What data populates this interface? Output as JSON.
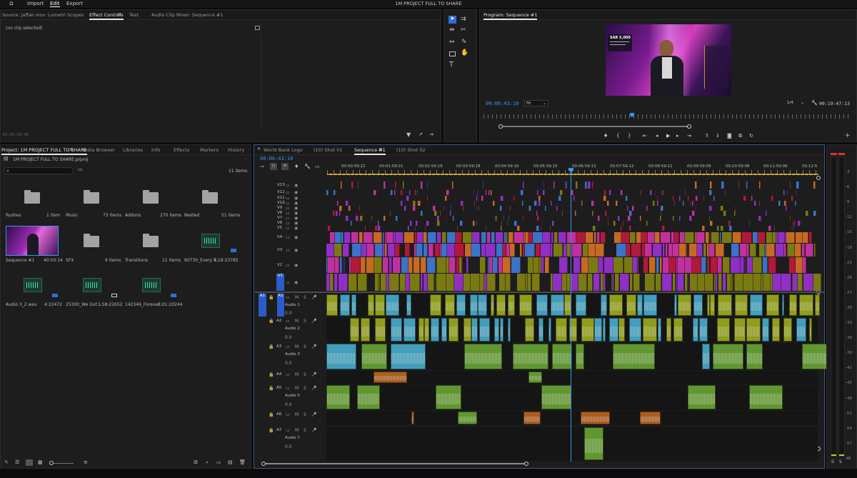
{
  "menu": {
    "home_icon": "home-icon",
    "items": [
      "Import",
      "Edit",
      "Export"
    ],
    "active": "Edit",
    "title": "1M PROJECT FULL  TO SHARE"
  },
  "source_panel": {
    "tabs": [
      "Source: jaffali.mov",
      "Lumetri Scopes",
      "Effect Controls",
      "Text",
      "Audio Clip Mixer: Sequence #1"
    ],
    "active_tab": "Effect Controls",
    "no_clip": "(no clip selected)",
    "timecode": "00:00:00:00"
  },
  "tools": [
    "selection-tool",
    "track-select-tool",
    "ripple-edit-tool",
    "razor-tool",
    "slip-tool",
    "pen-tool",
    "rectangle-tool",
    "hand-tool",
    "type-tool"
  ],
  "program_monitor": {
    "title": "Program: Sequence #1",
    "timecode": "00:06:43:10",
    "fit": "Fit",
    "resolution": "1/4",
    "duration": "00:19:47:13",
    "overlay_price": "SAR 5,000",
    "playhead_fraction": 0.325
  },
  "project_panel": {
    "tabs": [
      "Project: 1M PROJECT FULL  TO SHARE",
      "Media Browser",
      "Libraries",
      "Info",
      "Effects",
      "Markers",
      "History"
    ],
    "file": "1M PROJECT FULL  TO SHARE.prproj",
    "search_placeholder": "",
    "count": "11 items",
    "items": [
      {
        "name": "Rushes",
        "meta": "1 item",
        "kind": "folder"
      },
      {
        "name": "Music",
        "meta": "73 items",
        "kind": "folder"
      },
      {
        "name": "Addons",
        "meta": "270 items",
        "kind": "folder"
      },
      {
        "name": "Nested",
        "meta": "51 items",
        "kind": "folder"
      },
      {
        "name": "Sequence #1",
        "meta": "40:50:14",
        "kind": "sequence"
      },
      {
        "name": "SFX",
        "meta": "9 items",
        "kind": "folder"
      },
      {
        "name": "Transitions",
        "meta": "11 items",
        "kind": "folder"
      },
      {
        "name": "60730_Every T...",
        "meta": "4:18:23785",
        "kind": "audio"
      },
      {
        "name": "Audio 3_2.wav",
        "meta": "4:22472",
        "kind": "audio"
      },
      {
        "name": "25300_We Got ...",
        "meta": "1:58:22652",
        "kind": "audio"
      },
      {
        "name": "142346_Forever...",
        "meta": "2:01:20244",
        "kind": "audio"
      }
    ]
  },
  "timeline": {
    "tabs": [
      "World Bank Logo",
      "(10) Shot 01",
      "Sequence #1",
      "(10) Shot 02"
    ],
    "active_tab": "Sequence #1",
    "timecode": "00:06:43:10",
    "ruler": [
      "00:00:59:22",
      "00:01:59:21",
      "00:02:59:19",
      "00:03:59:18",
      "00:04:59:16",
      "00:05:59:15",
      "00:06:59:13",
      "00:07:59:12",
      "00:08:59:11",
      "00:09:59:09",
      "00:10:59:08",
      "00:11:59:06",
      "00:12:5"
    ],
    "video_tracks": [
      "V13",
      "V12",
      "V11",
      "V10",
      "V9",
      "V8",
      "V7",
      "V6",
      "V5",
      "V4",
      "V3",
      "V2",
      "V1"
    ],
    "audio_tracks": [
      {
        "id": "A1",
        "name": "Audio 1"
      },
      {
        "id": "A2",
        "name": "Audio 2"
      },
      {
        "id": "A3",
        "name": "Audio 3"
      },
      {
        "id": "A4",
        "name": ""
      },
      {
        "id": "A5",
        "name": "Audio 5"
      },
      {
        "id": "A6",
        "name": ""
      },
      {
        "id": "A7",
        "name": "Audio 7"
      }
    ],
    "src_v": "V1",
    "src_a": "A1",
    "track_buttons": {
      "mute": "M",
      "solo": "S",
      "vol": "0.0"
    }
  },
  "meter": {
    "scale": [
      "-3",
      "-6",
      "-9",
      "-12",
      "-15",
      "-18",
      "-21",
      "-24",
      "-27",
      "-30",
      "-33",
      "-36",
      "-39",
      "-42",
      "-45",
      "-48",
      "-51",
      "-54",
      "-57",
      "dB"
    ]
  },
  "colors": {
    "accent": "#3a93f5",
    "video_purple": "#8f2fc4",
    "video_magenta": "#c0319e",
    "video_blue": "#3a73c9",
    "video_red": "#b1193b",
    "video_orange": "#c66a22",
    "video_olive": "#7a7a13",
    "audio_yellowgreen": "#a6b51e",
    "audio_cyan": "#4ab7d8",
    "audio_green": "#6fae35"
  }
}
